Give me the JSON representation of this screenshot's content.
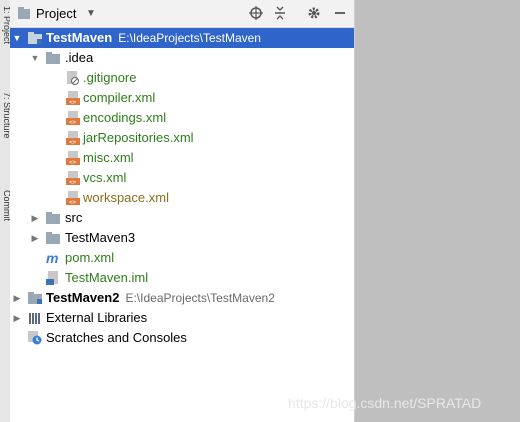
{
  "side_tabs": [
    "1: Project",
    "7: Structure",
    "Commit"
  ],
  "header": {
    "title": "Project",
    "icons": [
      "locate-icon",
      "collapse-all-icon",
      "gear-icon",
      "minimize-icon"
    ]
  },
  "tree": {
    "root": {
      "name": "TestMaven",
      "path": "E:\\IdeaProjects\\TestMaven"
    },
    "idea_folder": ".idea",
    "idea_files": [
      ".gitignore",
      "compiler.xml",
      "encodings.xml",
      "jarRepositories.xml",
      "misc.xml",
      "vcs.xml",
      "workspace.xml"
    ],
    "src": "src",
    "testmaven3": "TestMaven3",
    "pom": "pom.xml",
    "iml": "TestMaven.iml",
    "module2": {
      "name": "TestMaven2",
      "path": "E:\\IdeaProjects\\TestMaven2"
    },
    "external": "External Libraries",
    "scratches": "Scratches and Consoles"
  },
  "watermark": "https://blog.csdn.net/SPRATAD",
  "colors": {
    "selection": "#2f65ca",
    "git_added": "#2f7d1b",
    "xml_icon": "#e07a3c",
    "folder": "#9aa7b5"
  }
}
